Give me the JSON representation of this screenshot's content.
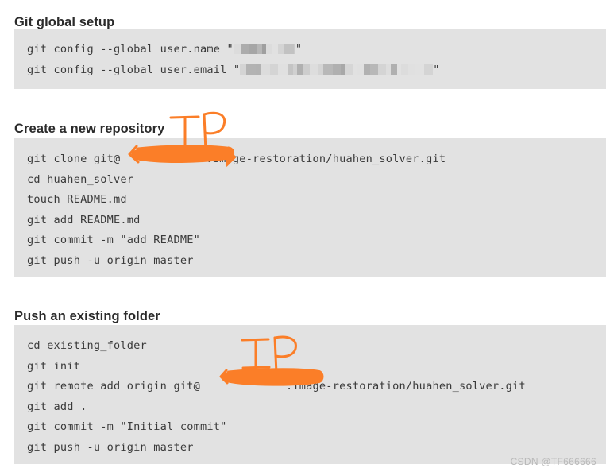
{
  "document": {
    "title": "Git global setup",
    "watermark": "CSDN @TF666666"
  },
  "colors": {
    "page_background": "#ffffff",
    "code_background": "#e2e2e2",
    "code_text": "#3a3a3a",
    "heading_text": "#2b2b2b",
    "annotation_orange": "#fb7e28",
    "watermark_text": "#b9b9b9",
    "mosaic_light": "#dadada",
    "mosaic_mid": "#bdbdbd",
    "mosaic_dark": "#9a9a9a"
  },
  "sections": [
    {
      "heading": "Git global setup",
      "lines": [
        {
          "prefix": "git config --global user.name \"",
          "redaction": "mosaic",
          "redaction_width": 78,
          "suffix": "\""
        },
        {
          "prefix": "git config --global user.email \"",
          "redaction": "mosaic",
          "redaction_width": 243,
          "suffix": "\""
        }
      ]
    },
    {
      "heading": "Create a new repository",
      "lines": [
        {
          "prefix": "git clone git@",
          "redaction": "orange-bar",
          "redaction_width": 108,
          "suffix": ":image-restoration/huahen_solver.git"
        },
        {
          "text": "cd huahen_solver"
        },
        {
          "text": "touch README.md"
        },
        {
          "text": "git add README.md"
        },
        {
          "text": "git commit -m \"add README\""
        },
        {
          "text": "git push -u origin master"
        }
      ]
    },
    {
      "heading": "Push an existing folder",
      "lines": [
        {
          "text": "cd existing_folder"
        },
        {
          "text": "git init"
        },
        {
          "prefix": "git remote add origin git@",
          "redaction": "orange-bar",
          "redaction_width": 108,
          "suffix": ":image-restoration/huahen_solver.git"
        },
        {
          "text": "git add ."
        },
        {
          "text": "git commit -m \"Initial commit\""
        },
        {
          "text": "git push -u origin master"
        }
      ]
    }
  ],
  "annotations": [
    {
      "label": "IP",
      "target": "clone-host",
      "note": "hand-drawn IP label with arrow over redacted host in Create a new repository block"
    },
    {
      "label": "IP",
      "target": "remote-host",
      "note": "hand-drawn IP label over redacted host in Push an existing folder block"
    }
  ]
}
